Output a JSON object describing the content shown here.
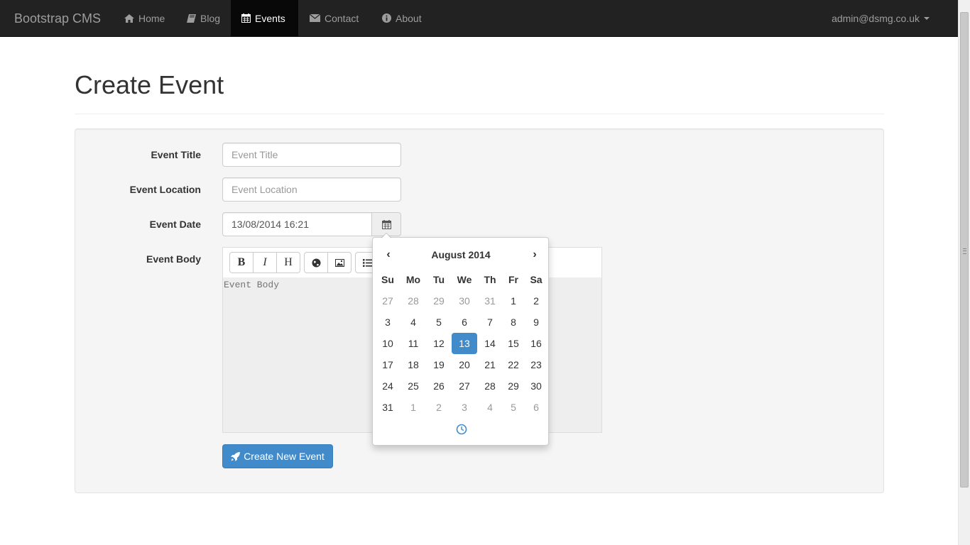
{
  "navbar": {
    "brand": "Bootstrap CMS",
    "items": [
      {
        "label": "Home",
        "icon": "home-icon",
        "active": false
      },
      {
        "label": "Blog",
        "icon": "book-icon",
        "active": false
      },
      {
        "label": "Events",
        "icon": "calendar-icon",
        "active": true
      },
      {
        "label": "Contact",
        "icon": "envelope-icon",
        "active": false
      },
      {
        "label": "About",
        "icon": "info-icon",
        "active": false
      }
    ],
    "user": "admin@dsmg.co.uk"
  },
  "page": {
    "title": "Create Event"
  },
  "form": {
    "title_label": "Event Title",
    "title_placeholder": "Event Title",
    "location_label": "Event Location",
    "location_placeholder": "Event Location",
    "date_label": "Event Date",
    "date_value": "13/08/2014 16:21",
    "body_label": "Event Body",
    "body_placeholder": "Event Body",
    "toolbar": {
      "bold": "B",
      "italic": "I",
      "heading": "H"
    },
    "submit_label": "Create New Event"
  },
  "datepicker": {
    "prev": "‹",
    "next": "›",
    "month_title": "August 2014",
    "weekdays": [
      "Su",
      "Mo",
      "Tu",
      "We",
      "Th",
      "Fr",
      "Sa"
    ],
    "weeks": [
      [
        {
          "d": "27",
          "m": true
        },
        {
          "d": "28",
          "m": true
        },
        {
          "d": "29",
          "m": true
        },
        {
          "d": "30",
          "m": true
        },
        {
          "d": "31",
          "m": true
        },
        {
          "d": "1"
        },
        {
          "d": "2"
        }
      ],
      [
        {
          "d": "3"
        },
        {
          "d": "4"
        },
        {
          "d": "5"
        },
        {
          "d": "6"
        },
        {
          "d": "7"
        },
        {
          "d": "8"
        },
        {
          "d": "9"
        }
      ],
      [
        {
          "d": "10"
        },
        {
          "d": "11"
        },
        {
          "d": "12"
        },
        {
          "d": "13",
          "a": true
        },
        {
          "d": "14"
        },
        {
          "d": "15"
        },
        {
          "d": "16"
        }
      ],
      [
        {
          "d": "17"
        },
        {
          "d": "18"
        },
        {
          "d": "19"
        },
        {
          "d": "20"
        },
        {
          "d": "21"
        },
        {
          "d": "22"
        },
        {
          "d": "23"
        }
      ],
      [
        {
          "d": "24"
        },
        {
          "d": "25"
        },
        {
          "d": "26"
        },
        {
          "d": "27"
        },
        {
          "d": "28"
        },
        {
          "d": "29"
        },
        {
          "d": "30"
        }
      ],
      [
        {
          "d": "31"
        },
        {
          "d": "1",
          "m": true
        },
        {
          "d": "2",
          "m": true
        },
        {
          "d": "3",
          "m": true
        },
        {
          "d": "4",
          "m": true
        },
        {
          "d": "5",
          "m": true
        },
        {
          "d": "6",
          "m": true
        }
      ]
    ]
  },
  "colors": {
    "navbar_bg": "#222222",
    "primary": "#428bca",
    "well_bg": "#f5f5f5"
  }
}
